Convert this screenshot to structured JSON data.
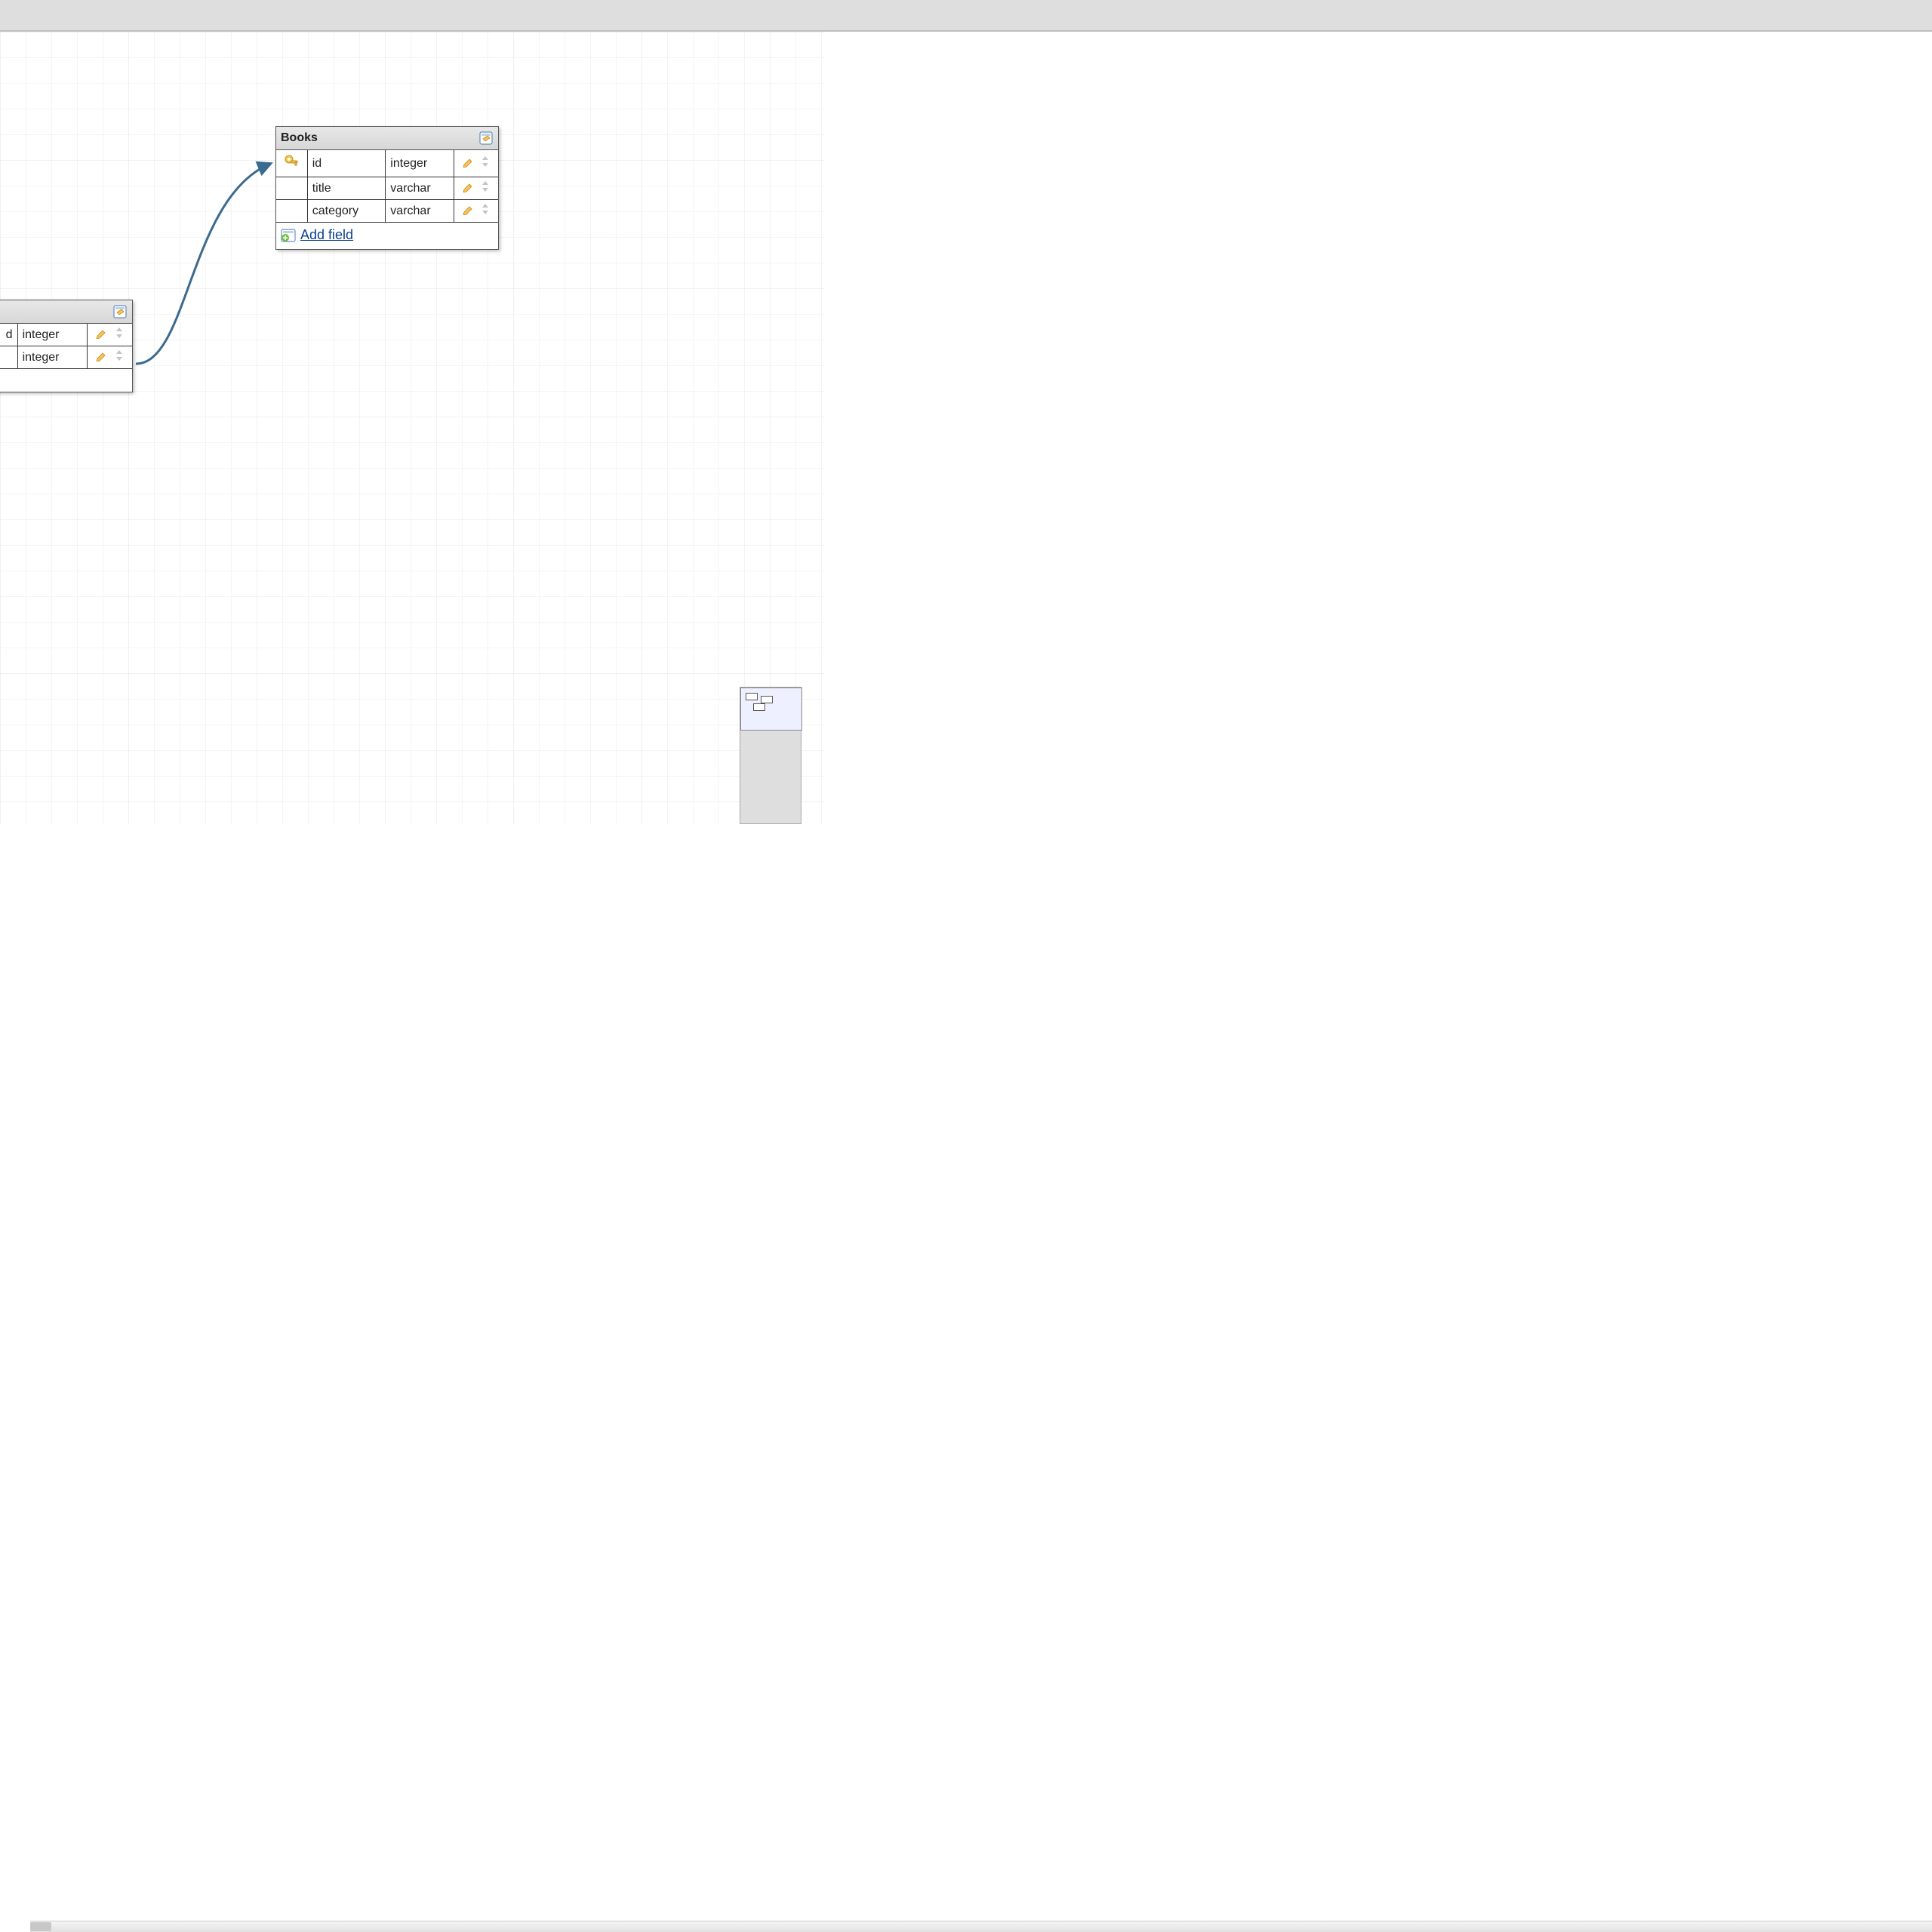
{
  "tables": {
    "books": {
      "title": "Books",
      "fields": [
        {
          "key": true,
          "name": "id",
          "type": "integer"
        },
        {
          "key": false,
          "name": "title",
          "type": "varchar"
        },
        {
          "key": false,
          "name": "category",
          "type": "varchar"
        }
      ],
      "add_field_label": "Add field"
    },
    "left_partial": {
      "fields": [
        {
          "name_fragment": "d",
          "type": "integer"
        },
        {
          "name_fragment": "",
          "type": "integer"
        }
      ]
    }
  },
  "colors": {
    "connector": "#3b6a8f",
    "grid_minor": "#f4f4f4",
    "grid_major": "#f0f0f0",
    "link": "#0a3f8a"
  }
}
